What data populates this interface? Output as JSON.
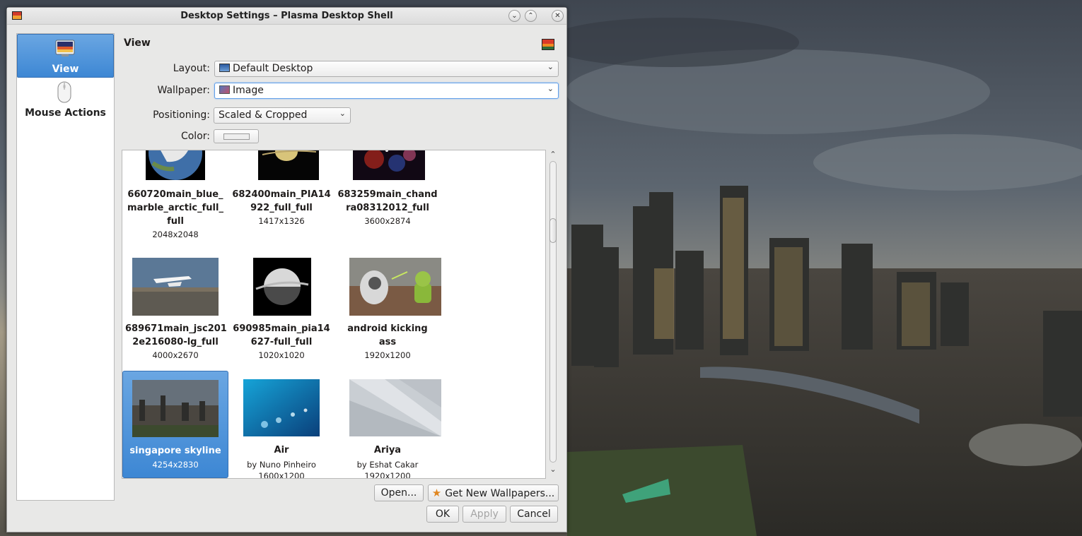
{
  "window": {
    "title": "Desktop Settings – Plasma Desktop Shell",
    "controls": [
      "minimize",
      "maximize",
      "close"
    ]
  },
  "sidebar": {
    "items": [
      {
        "label": "View",
        "icon": "monitor-icon",
        "active": true
      },
      {
        "label": "Mouse Actions",
        "icon": "mouse-icon",
        "active": false
      }
    ]
  },
  "page": {
    "heading": "View"
  },
  "form": {
    "layout": {
      "label": "Layout:",
      "value": "Default Desktop"
    },
    "wallpaper": {
      "label": "Wallpaper:",
      "value": "Image"
    },
    "positioning": {
      "label": "Positioning:",
      "value": "Scaled & Cropped"
    },
    "color": {
      "label": "Color:",
      "value": "#eeeeee"
    }
  },
  "wallpapers": [
    {
      "name": "660720main_blue_ marble_arctic_full_ full",
      "lines": [
        "660720main_blue_",
        "marble_arctic_full_",
        "full"
      ],
      "size": "2048x2048",
      "author": ""
    },
    {
      "name": "682400main_PIA14922_full_full",
      "lines": [
        "682400main_PIA14",
        "922_full_full"
      ],
      "size": "1417x1326",
      "author": ""
    },
    {
      "name": "683259main_chandra08312012_full",
      "lines": [
        "683259main_chand",
        "ra08312012_full"
      ],
      "size": "3600x2874",
      "author": ""
    },
    {
      "name": "689671main_jsc2012e216080-lg_full",
      "lines": [
        "689671main_jsc201",
        "2e216080-lg_full"
      ],
      "size": "4000x2670",
      "author": ""
    },
    {
      "name": "690985main_pia14627-full_full",
      "lines": [
        "690985main_pia14",
        "627-full_full"
      ],
      "size": "1020x1020",
      "author": ""
    },
    {
      "name": "android kicking ass",
      "lines": [
        "android kicking",
        "ass"
      ],
      "size": "1920x1200",
      "author": ""
    },
    {
      "name": "singapore skyline",
      "lines": [
        "singapore skyline"
      ],
      "size": "4254x2830",
      "author": "",
      "selected": true
    },
    {
      "name": "Air",
      "lines": [
        "Air"
      ],
      "size": "1600x1200",
      "author": "by Nuno Pinheiro"
    },
    {
      "name": "Ariya",
      "lines": [
        "Ariya"
      ],
      "size": "1920x1200",
      "author": "by Eshat Cakar"
    }
  ],
  "buttons": {
    "open": "Open...",
    "get_new": "Get New Wallpapers...",
    "ok": "OK",
    "apply": "Apply",
    "cancel": "Cancel"
  },
  "colors": {
    "selection": "#3d87d4",
    "window_bg": "#e8e8e7",
    "dusk_sky": "#5a6470"
  }
}
